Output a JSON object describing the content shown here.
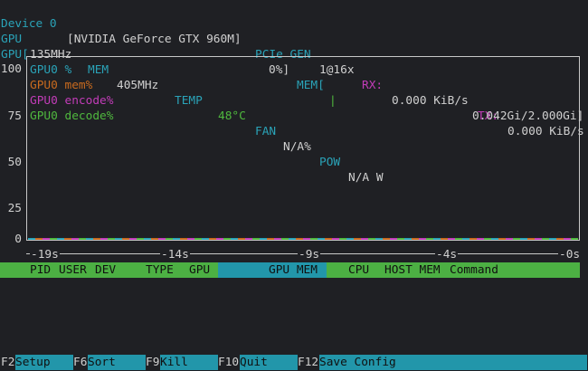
{
  "device": {
    "label": "Device 0",
    "name": "[NVIDIA GeForce GTX 960M]",
    "pcie_label": "PCIe GEN",
    "pcie_value": "1@16x",
    "rx_label": "RX:",
    "rx_value": "0.000 KiB/s",
    "tx_label": "TX:",
    "tx_value": "0.000 KiB/s"
  },
  "stats": {
    "gpu_label": "GPU",
    "gpu_clock": "135MHz",
    "mem_label": "MEM",
    "mem_clock": "405MHz",
    "temp_label": "TEMP",
    "temp_value": "48°C",
    "fan_label": "FAN",
    "fan_value": "N/A%",
    "pow_label": "POW",
    "pow_value": "N/A W"
  },
  "bars": {
    "gpu_label": "GPU[",
    "gpu_value": "0%]",
    "gpu_fraction": 0,
    "mem_label": "MEM[",
    "mem_fill": "|",
    "mem_value": "0.042Gi/2.000Gi]",
    "mem_fraction": 0.021
  },
  "chart_data": {
    "type": "line",
    "yticks": [
      "100",
      "75",
      "50",
      "25",
      "0"
    ],
    "ylim": [
      0,
      100
    ],
    "xticks": [
      "-19s",
      "-14s",
      "-9s",
      "-4s",
      "-0s"
    ],
    "legend_placement": "top-left",
    "series": [
      {
        "name": "GPU0 %",
        "color": "#2aa3b8",
        "values": [
          0,
          0,
          0,
          0,
          0
        ]
      },
      {
        "name": "GPU0 mem%",
        "color": "#c86a1e",
        "values": [
          0,
          0,
          0,
          0,
          0
        ]
      },
      {
        "name": "GPU0 encode%",
        "color": "#c23cb8",
        "values": [
          0,
          0,
          0,
          0,
          0
        ]
      },
      {
        "name": "GPU0 decode%",
        "color": "#4fb83e",
        "values": [
          0,
          0,
          0,
          0,
          0
        ]
      }
    ]
  },
  "process_header": {
    "pid": "PID",
    "user": "USER",
    "dev": "DEV",
    "type": "TYPE",
    "gpu": "GPU",
    "gpu_mem": "GPU MEM",
    "cpu": "CPU",
    "host_mem": "HOST MEM",
    "command": "Command"
  },
  "fkeys": [
    {
      "key": "F2",
      "label": "Setup"
    },
    {
      "key": "F6",
      "label": "Sort"
    },
    {
      "key": "F9",
      "label": "Kill"
    },
    {
      "key": "F10",
      "label": "Quit"
    },
    {
      "key": "F12",
      "label": "Save Config"
    }
  ]
}
